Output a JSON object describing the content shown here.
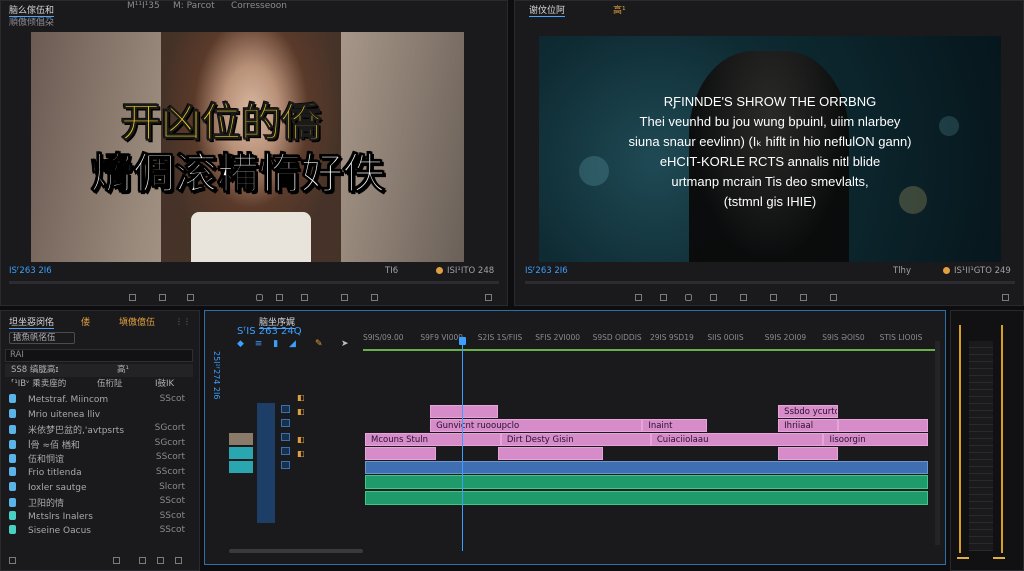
{
  "source_monitor": {
    "tabs": [
      "脑么傢伍和",
      "順傲倾倡朶",
      "M¹¹I¹35",
      "M: Parcot",
      "Corresseoon"
    ],
    "overlay_line1": "开凶位的僑",
    "overlay_line2": "熁倜滚糒惰好佚",
    "timecode": "ISᶠ263 2I6",
    "timecode_right": "ISI¹ITO 248",
    "zoom": "TI6"
  },
  "program_monitor": {
    "tabs": [
      "谢伩位阿",
      "高¹"
    ],
    "subtitle_lines": [
      "RƑINNDE'S SHROW THE ORRBNG",
      "Thei veunhd bu jou wung bpuinl, uiim nlarbey",
      "siuna snaur eevlinn) (Iₖ hiflt in hio neflulON gann)",
      "eHCIT-KORLE RCTS annalis nitl blide",
      "urtmanp mcrain Tis deo smevlalts,",
      "(tstmnl gis IHIE)"
    ],
    "timecode": "ISᶠ263 2I6",
    "timecode_mid": "Tlhy",
    "timecode_right": "IS¹II¹GTO 249"
  },
  "project_panel": {
    "tabs": [
      "坦坐惡闵佲",
      "偻",
      "塡傲億伍"
    ],
    "dropdown": "搶魚帆佲伍",
    "search": "RAI",
    "header_name": "SS8 缟胧高ɪ",
    "header_col": "高¹",
    "folder_label": "⸢¹IBᵛ 乘卖座的",
    "folder_col": "伍桁阯",
    "folder_col2": "Ι鼓IK",
    "items": [
      {
        "name": "Metstraf. Miincom",
        "count": "SScot",
        "color": "#5ab4e8"
      },
      {
        "name": "Mrio uitenea lliv",
        "count": "",
        "color": "#5ab4e8"
      },
      {
        "name": "米依梦巴盆的,'avtpsrts",
        "count": "SGcort",
        "color": "#5ab4e8"
      },
      {
        "name": "ꟾ骨 ≈佰 楢和",
        "count": "SGcort",
        "color": "#5ab4e8"
      },
      {
        "name": "伍和恫谊",
        "count": "SScort",
        "color": "#5ab4e8"
      },
      {
        "name": "Frio titlenda",
        "count": "SScort",
        "color": "#5ab4e8"
      },
      {
        "name": "Ioxler sautge",
        "count": "Slcort",
        "color": "#5ab4e8"
      },
      {
        "name": "卫阳的情",
        "count": "SScot",
        "color": "#5ab4e8"
      },
      {
        "name": "Mɛtslrs Inalers",
        "count": "SScot",
        "color": "#4ad0c0"
      },
      {
        "name": "Siseine Oacus",
        "count": "SScot",
        "color": "#4ad0c0"
      }
    ]
  },
  "timeline": {
    "tab": "脑坐序娓",
    "timecode": "SᶠIS 263 24Q",
    "side_timecode": "25I²ᶠ274 2I6",
    "ruler": [
      "S9IS/09.00",
      "S9F9 VI009",
      "S2IS 1S/FIIS",
      "SFIS 2VI000",
      "S9SD OIDDIS",
      "29IS 9SD19",
      "SIIS 0OIIS",
      "S9IS 2OI09",
      "S9IS ƏOIS0",
      "STIS LIO0IS"
    ],
    "clips": {
      "v3": [
        {
          "label": "",
          "from": 0.115,
          "to": 0.235
        },
        {
          "label": "Ssbdo ycurtoat",
          "from": 0.73,
          "to": 0.835
        }
      ],
      "v2": [
        {
          "label": "Gunvicnt ruooupclo",
          "from": 0.115,
          "to": 0.49
        },
        {
          "label": "Inaint",
          "from": 0.49,
          "to": 0.605
        },
        {
          "label": "Ihriiaal",
          "from": 0.73,
          "to": 0.835
        },
        {
          "label": "",
          "from": 0.835,
          "to": 0.995
        }
      ],
      "v1": [
        {
          "label": "Mcouns Stuln",
          "from": 0.0,
          "to": 0.24
        },
        {
          "label": "Dirt Desty Gisin",
          "from": 0.24,
          "to": 0.505
        },
        {
          "label": "Cuiaciiolaau",
          "from": 0.505,
          "to": 0.81
        },
        {
          "label": "Iisoorgin",
          "from": 0.81,
          "to": 0.995
        }
      ],
      "v0": [
        {
          "label": "",
          "from": 0.0,
          "to": 0.125
        },
        {
          "label": "",
          "from": 0.235,
          "to": 0.42
        },
        {
          "label": "",
          "from": 0.73,
          "to": 0.835
        }
      ]
    }
  },
  "colors": {
    "accent": "#3a9fff",
    "pink_clip": "#d58cc8",
    "blue_clip": "#3f6fb0",
    "green_audio": "#1f9a6a",
    "overlay_yellow": "#f6d21f"
  }
}
